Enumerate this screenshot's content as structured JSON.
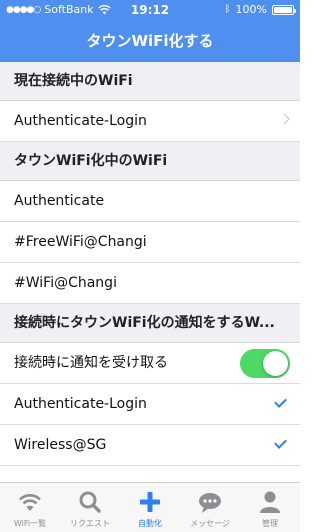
{
  "status_bar": {
    "carrier": "SoftBank",
    "time": "19:12",
    "battery": "100%"
  },
  "nav": {
    "title": "タウンWiFi化する"
  },
  "sections": {
    "current": {
      "header": "現在接続中のWiFi",
      "items": [
        {
          "label": "Authenticate-Login"
        }
      ]
    },
    "townified": {
      "header": "タウンWiFi化中のWiFi",
      "items": [
        {
          "label": "Authenticate"
        },
        {
          "label": "#FreeWiFi@Changi"
        },
        {
          "label": "#WiFi@Changi"
        }
      ]
    },
    "notify": {
      "header": "接続時にタウンWiFi化の通知をするW...",
      "toggle_label": "接続時に通知を受け取る",
      "toggle_on": true,
      "items": [
        {
          "label": "Authenticate-Login",
          "checked": true
        },
        {
          "label": "Wireless@SG",
          "checked": true
        }
      ]
    }
  },
  "tabs": [
    {
      "label": "WiFi一覧",
      "icon": "wifi-icon"
    },
    {
      "label": "リクエスト",
      "icon": "search-icon"
    },
    {
      "label": "自動化",
      "icon": "plus-icon",
      "active": true
    },
    {
      "label": "メッセージ",
      "icon": "chat-bubble-icon"
    },
    {
      "label": "管理",
      "icon": "person-icon"
    }
  ],
  "colors": {
    "accent": "#4f8ff0",
    "section_bg": "#efeff4",
    "toggle_on": "#4cd964",
    "check": "#2f80ed"
  }
}
